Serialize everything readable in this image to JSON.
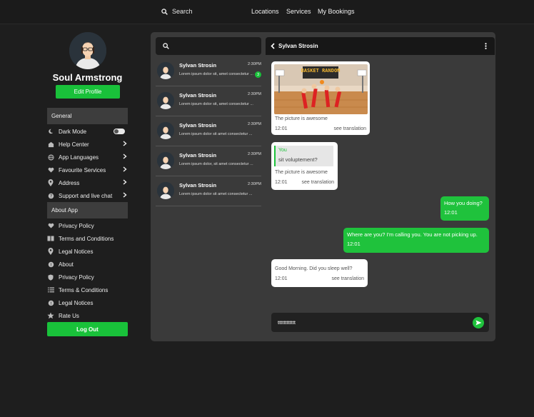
{
  "nav": {
    "search_label": "Search",
    "links": [
      "Locations",
      "Services",
      "My Bookings"
    ]
  },
  "profile": {
    "name": "Soul Armstrong",
    "edit_label": "Edit Profile"
  },
  "sidebar": {
    "general_heading": "General",
    "general_items": [
      {
        "label": "Dark Mode",
        "icon": "moon-icon"
      },
      {
        "label": "Help Center",
        "icon": "help-center-icon"
      },
      {
        "label": "App Languages",
        "icon": "globe-icon"
      },
      {
        "label": "Favourite Services",
        "icon": "heart-icon"
      },
      {
        "label": "Address",
        "icon": "location-pin-icon"
      },
      {
        "label": "Support and live chat",
        "icon": "support-icon"
      }
    ],
    "about_heading": "About App",
    "about_items": [
      {
        "label": "Privacy Policy",
        "icon": "heart-icon"
      },
      {
        "label": "Terms and Conditions",
        "icon": "book-icon"
      },
      {
        "label": "Legal Notices",
        "icon": "location-pin-icon"
      },
      {
        "label": "About",
        "icon": "info-icon"
      },
      {
        "label": "Privacy Policy",
        "icon": "shield-icon"
      },
      {
        "label": "Terms & Conditions",
        "icon": "list-icon"
      },
      {
        "label": "Legal Notices",
        "icon": "info-icon"
      },
      {
        "label": "Rate Us",
        "icon": "star-icon"
      }
    ],
    "logout_label": "Log Out",
    "dark_mode_on": false
  },
  "conversations": [
    {
      "name": "Sylvan Strosin",
      "time": "2:30PM",
      "preview": "Lorem ipsum dolor sit, amet consectetur ...",
      "unread": "3"
    },
    {
      "name": "Sylvan Strosin",
      "time": "2:30PM",
      "preview": "Lorem ipsum dolor sit, amet consectetur ..."
    },
    {
      "name": "Sylvan Strosin",
      "time": "2:30PM",
      "preview": "Lorem ipsum dolor sit amet consectetur ..."
    },
    {
      "name": "Sylvan Strosin",
      "time": "2:30PM",
      "preview": "Lorem ipsum dolor, sit amet consectetur ..."
    },
    {
      "name": "Sylvan Strosin",
      "time": "2:30PM",
      "preview": "Lorem ipsum dolor sit amet consectetur ..."
    }
  ],
  "chat": {
    "title": "Sylvan Strosin",
    "messages": [
      {
        "type": "incoming-image",
        "image_label": "BASKET RANDOM",
        "text": "The picture is awesome",
        "time": "12:01",
        "action": "see translation"
      },
      {
        "type": "incoming-reply",
        "quote_author": "You",
        "quote_text": "sit voluptement?",
        "text": "The picture is awesome",
        "time": "12:01",
        "action": "see translation"
      },
      {
        "type": "outgoing",
        "text": "How you doing?",
        "time": "12:01"
      },
      {
        "type": "outgoing",
        "text": "Where are you? I'm calling you. You are not picking up.",
        "time": "12:01"
      },
      {
        "type": "incoming",
        "text": "Good Morning. Did you sleep well?",
        "time": "12:01",
        "action": "see translation"
      }
    ],
    "composer_value": "tttttttttttt"
  },
  "colors": {
    "accent": "#1fc23c",
    "background": "#1e1e1e",
    "panel": "#3a3a3a",
    "header": "#171717"
  }
}
